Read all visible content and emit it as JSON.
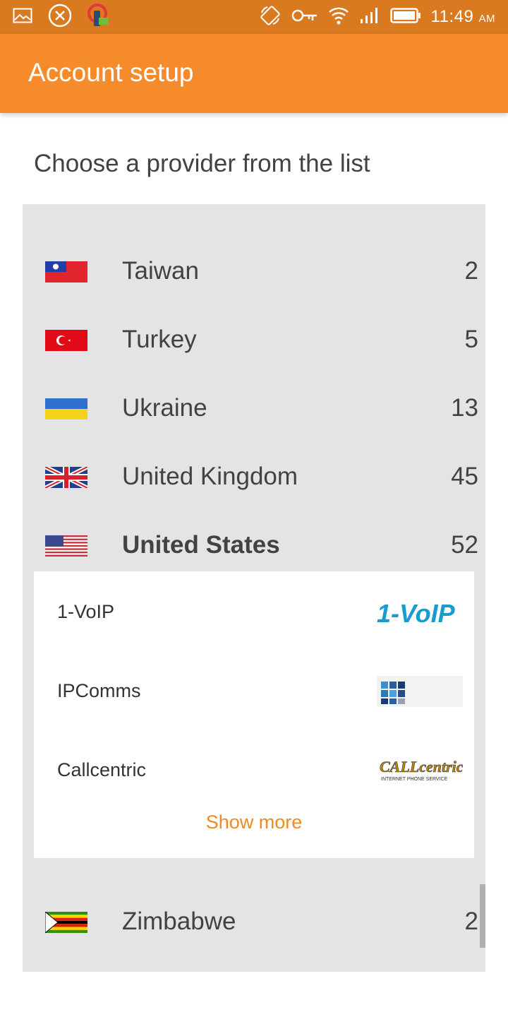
{
  "status_bar": {
    "icons_left": [
      "gallery-icon",
      "close-circle-icon",
      "vpn-key-app-icon"
    ],
    "icons_right": [
      "rotate-icon",
      "key-icon",
      "wifi-icon",
      "signal-icon",
      "battery-icon"
    ],
    "time": "11:49",
    "ampm": "AM"
  },
  "app_bar": {
    "title": "Account setup"
  },
  "instructions": "Choose a provider from the list",
  "countries": [
    {
      "name": "Taiwan",
      "count": "2",
      "flag_icon": "taiwan-flag-icon"
    },
    {
      "name": "Turkey",
      "count": "5",
      "flag_icon": "turkey-flag-icon"
    },
    {
      "name": "Ukraine",
      "count": "13",
      "flag_icon": "ukraine-flag-icon"
    },
    {
      "name": "United Kingdom",
      "count": "45",
      "flag_icon": "uk-flag-icon"
    },
    {
      "name": "United States",
      "count": "52",
      "flag_icon": "us-flag-icon",
      "expanded": true
    },
    {
      "name": "Zimbabwe",
      "count": "2",
      "flag_icon": "zimbabwe-flag-icon"
    }
  ],
  "providers": [
    {
      "name": "1-VoIP",
      "logo_text": "1-VoIP"
    },
    {
      "name": "IPComms",
      "logo_text": ""
    },
    {
      "name": "Callcentric",
      "logo_text": "CALLcentric",
      "logo_subtext": "INTERNET PHONE SERVICE"
    }
  ],
  "show_more_label": "Show more",
  "colors": {
    "status_bar": "#d97a20",
    "app_bar": "#f68b2c",
    "accent": "#f08a24",
    "panel_bg": "#e4e4e4",
    "voip_blue": "#1a9bd0"
  }
}
